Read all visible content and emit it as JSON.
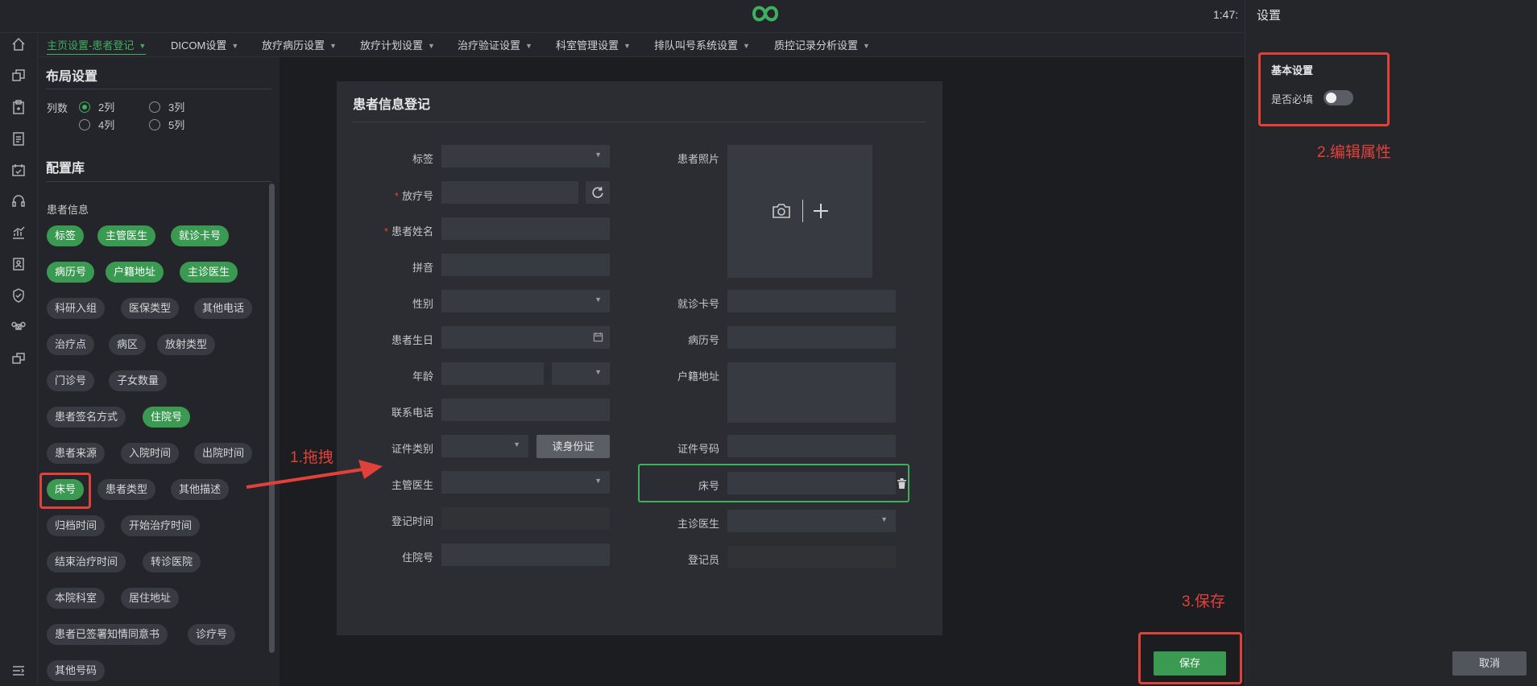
{
  "clock": "1:47:",
  "menu_tabs": [
    "主页设置-患者登记",
    "DICOM设置",
    "放疗病历设置",
    "放疗计划设置",
    "治疗验证设置",
    "科室管理设置",
    "排队叫号系统设置",
    "质控记录分析设置"
  ],
  "left_panel": {
    "layout_title": "布局设置",
    "columns_label": "列数",
    "columns_options": [
      "2列",
      "3列",
      "4列",
      "5列"
    ],
    "columns_selected": "2列",
    "library_title": "配置库",
    "group_label": "患者信息",
    "chips": [
      "标签",
      "主管医生",
      "就诊卡号",
      "病历号",
      "户籍地址",
      "主诊医生",
      "科研入组",
      "医保类型",
      "其他电话",
      "治疗点",
      "病区",
      "放射类型",
      "门诊号",
      "子女数量",
      "患者签名方式",
      "住院号",
      "患者来源",
      "入院时间",
      "出院时间",
      "床号",
      "患者类型",
      "其他描述",
      "归档时间",
      "开始治疗时间",
      "结束治疗时间",
      "转诊医院",
      "本院科室",
      "居住地址",
      "患者已签署知情同意书",
      "诊疗号",
      "其他号码"
    ]
  },
  "form": {
    "title": "患者信息登记",
    "left_labels": [
      "标签",
      "放疗号",
      "患者姓名",
      "拼音",
      "性别",
      "患者生日",
      "年龄",
      "联系电话",
      "证件类别",
      "主管医生",
      "登记时间",
      "住院号"
    ],
    "required_marker": "*",
    "read_id_button": "读身份证",
    "right_labels": [
      "患者照片",
      "就诊卡号",
      "病历号",
      "户籍地址",
      "证件号码",
      "床号",
      "主诊医生",
      "登记员"
    ]
  },
  "settings_panel": {
    "title": "设置",
    "basic_title": "基本设置",
    "required_label": "是否必填",
    "required_on": false,
    "cancel": "取消"
  },
  "save_button": "保存",
  "annotations": [
    "1.拖拽",
    "2.编辑属性",
    "3.保存"
  ],
  "colors": {
    "accent": "#3fae5e",
    "annotation": "#e2413a"
  }
}
